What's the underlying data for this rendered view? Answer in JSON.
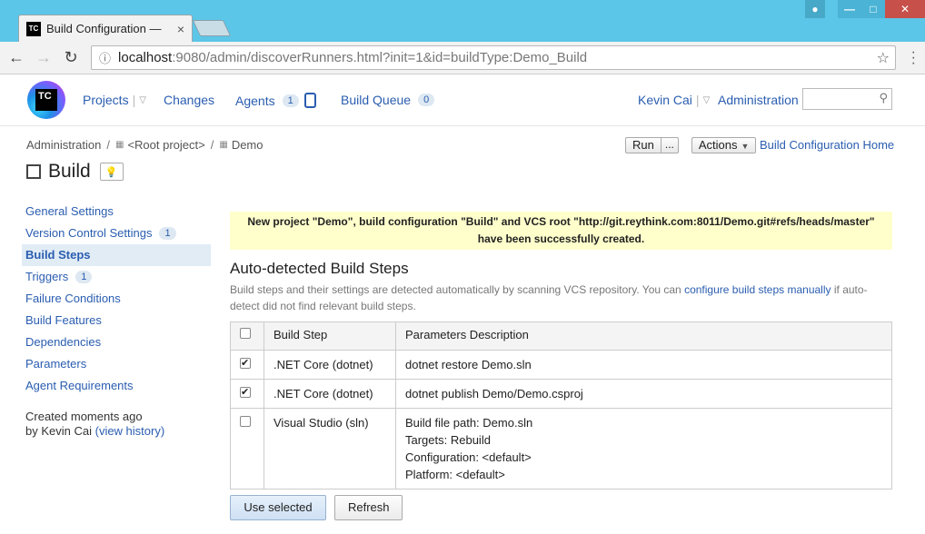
{
  "browser": {
    "tab_title": "Build Configuration —",
    "favicon_text": "TC",
    "url_host": "localhost",
    "url_rest": ":9080/admin/discoverRunners.html?init=1&id=buildType:Demo_Build"
  },
  "header": {
    "logo_text": "TC",
    "nav": {
      "projects": "Projects",
      "changes": "Changes",
      "agents": "Agents",
      "agents_count": "1",
      "build_queue": "Build Queue",
      "build_queue_count": "0"
    },
    "user": "Kevin Cai",
    "administration": "Administration"
  },
  "breadcrumb": {
    "admin": "Administration",
    "root": "<Root project>",
    "project": "Demo",
    "separator": "/"
  },
  "actions": {
    "run": "Run",
    "run_more": "...",
    "actions": "Actions",
    "home": "Build Configuration Home"
  },
  "page": {
    "title": "Build"
  },
  "sidebar": {
    "items": [
      {
        "label": "General Settings",
        "badge": ""
      },
      {
        "label": "Version Control Settings",
        "badge": "1"
      },
      {
        "label": "Build Steps",
        "badge": ""
      },
      {
        "label": "Triggers",
        "badge": "1"
      },
      {
        "label": "Failure Conditions",
        "badge": ""
      },
      {
        "label": "Build Features",
        "badge": ""
      },
      {
        "label": "Dependencies",
        "badge": ""
      },
      {
        "label": "Parameters",
        "badge": ""
      },
      {
        "label": "Agent Requirements",
        "badge": ""
      }
    ],
    "created": "Created moments ago",
    "by_prefix": "by Kevin Cai",
    "view_history": "(view history)"
  },
  "notice": {
    "line1": "New project \"Demo\", build configuration \"Build\" and VCS root \"http://git.reythink.com:8011/Demo.git#refs/heads/master\"",
    "line2": "have been successfully created."
  },
  "section": {
    "title": "Auto-detected Build Steps",
    "desc_part1": "Build steps and their settings are detected automatically by scanning VCS repository. You can",
    "desc_link": "configure build steps manually",
    "desc_part2": "if auto-detect did not find relevant build steps."
  },
  "table": {
    "headers": {
      "step": "Build Step",
      "params": "Parameters Description"
    },
    "rows": [
      {
        "checked": true,
        "step": ".NET Core (dotnet)",
        "params": [
          "dotnet restore Demo.sln"
        ]
      },
      {
        "checked": true,
        "step": ".NET Core (dotnet)",
        "params": [
          "dotnet publish Demo/Demo.csproj"
        ]
      },
      {
        "checked": false,
        "step": "Visual Studio (sln)",
        "params": [
          "Build file path: Demo.sln",
          "Targets: Rebuild",
          "Configuration: <default>",
          "Platform: <default>"
        ]
      }
    ]
  },
  "buttons": {
    "use_selected": "Use selected",
    "refresh": "Refresh"
  }
}
